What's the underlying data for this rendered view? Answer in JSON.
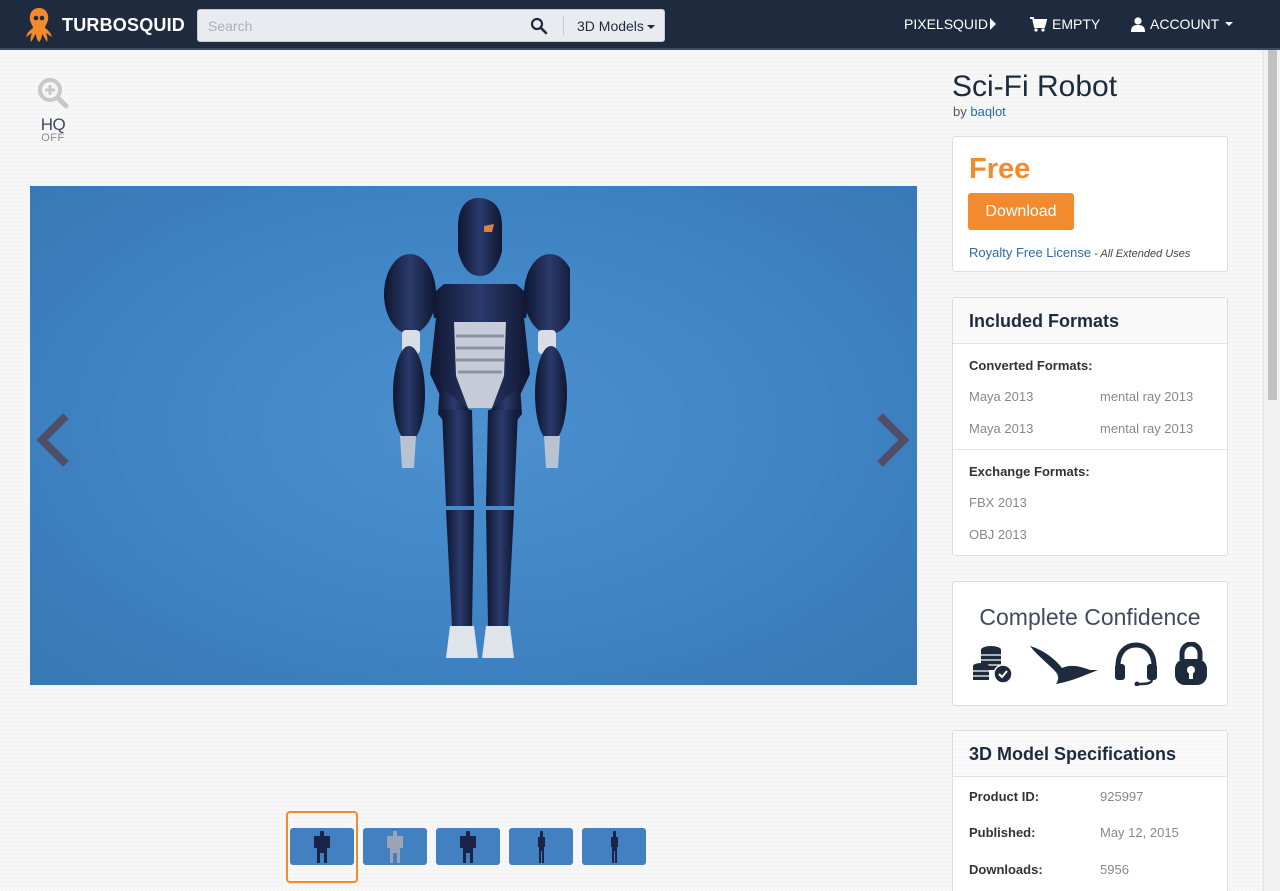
{
  "nav": {
    "brand": "TURBOSQUID",
    "search_placeholder": "Search",
    "search_category": "3D Models",
    "pixelsquid": "PIXELSQUID",
    "cart": "EMPTY",
    "account": "ACCOUNT"
  },
  "viewer": {
    "hq_label": "HQ",
    "hq_state": "OFF"
  },
  "product": {
    "title": "Sci-Fi Robot",
    "by_prefix": "by",
    "author": "baqlot",
    "price": "Free",
    "download_label": "Download",
    "license": "Royalty Free License",
    "license_note": "- All Extended Uses"
  },
  "formats": {
    "heading": "Included Formats",
    "converted_label": "Converted Formats:",
    "converted": [
      [
        "Maya 2013",
        "mental ray 2013"
      ],
      [
        "Maya 2013",
        "mental ray 2013"
      ]
    ],
    "exchange_label": "Exchange Formats:",
    "exchange": [
      "FBX 2013",
      "OBJ 2013"
    ]
  },
  "confidence": {
    "heading": "Complete Confidence",
    "icons": [
      "coins-check-icon",
      "bird-icon",
      "headset-icon",
      "lock-icon"
    ]
  },
  "specs": {
    "heading": "3D Model Specifications",
    "rows": [
      {
        "label": "Product ID:",
        "value": "925997"
      },
      {
        "label": "Published:",
        "value": "May 12, 2015"
      },
      {
        "label": "Downloads:",
        "value": "5956"
      }
    ]
  },
  "thumbnails": {
    "count": 5,
    "selected_index": 0
  },
  "colors": {
    "nav_bg": "#1e2b3e",
    "accent": "#f28a2e",
    "viewer_bg": "#3f84c4",
    "link": "#2a6aa9"
  }
}
